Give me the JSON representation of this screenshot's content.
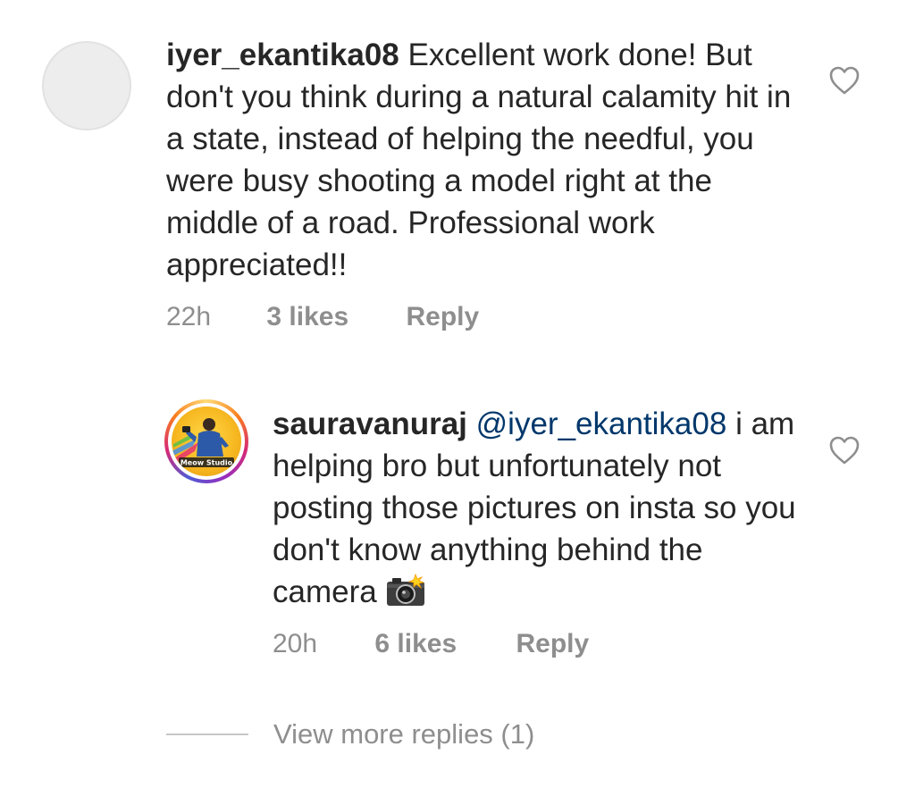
{
  "comment_main": {
    "username": "iyer_ekantika08",
    "text": "Excellent work done! But don't you think during a natural calamity hit in a state, instead of helping the needful, you were busy shooting a model right at the middle of a road. Professional work appreciated!!",
    "time": "22h",
    "likes": "3 likes",
    "reply_label": "Reply",
    "like_icon": "heart-outline-icon"
  },
  "comment_reply": {
    "username": "sauravanuraj",
    "mention": "@iyer_ekantika08",
    "text": "i am helping bro but unfortunately not posting those pictures on insta so you don't know anything behind the camera",
    "emoji": "camera-with-flash",
    "avatar_label": "Meow Studio",
    "time": "20h",
    "likes": "6 likes",
    "reply_label": "Reply",
    "like_icon": "heart-outline-icon"
  },
  "view_more": {
    "label": "View more replies (1)"
  },
  "colors": {
    "text": "#262626",
    "meta": "#8e8e8e",
    "mention": "#00376b",
    "divider": "#c7c7c7"
  }
}
